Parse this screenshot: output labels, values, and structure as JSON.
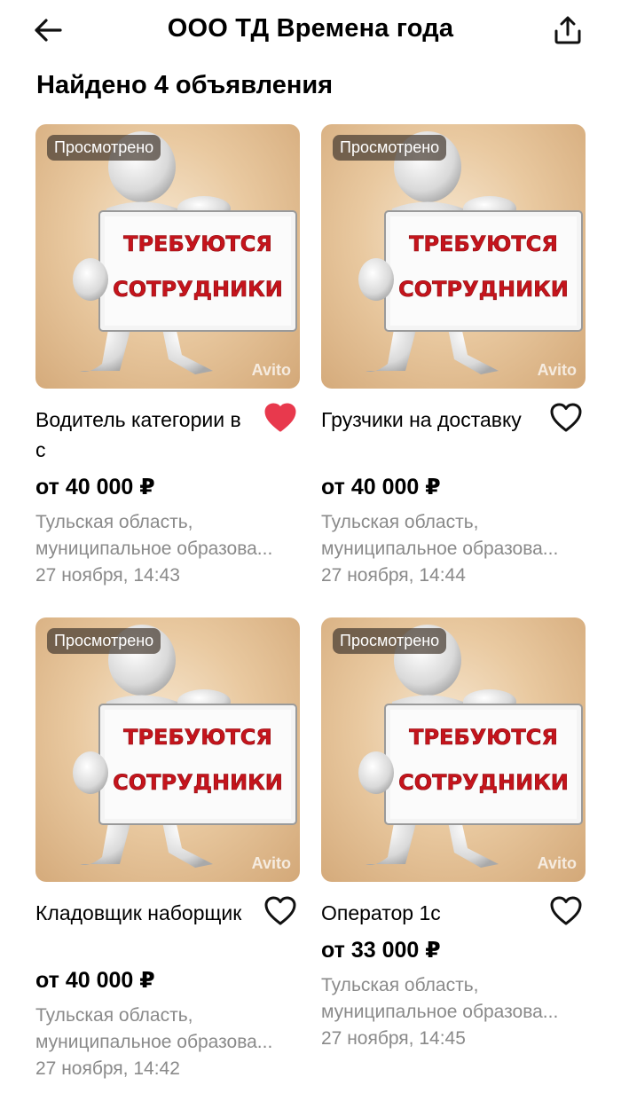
{
  "header": {
    "title": "ООО ТД Времена года",
    "back_icon": "arrow-left-icon",
    "share_icon": "share-upload-icon"
  },
  "results_count_text": "Найдено 4 объявления",
  "cards": [
    {
      "badge": "Просмотрено",
      "image_text_1": "ТРЕБУЮТСЯ",
      "image_text_2": "СОТРУДНИКИ",
      "watermark": "Avito",
      "title": "Водитель категории в с",
      "price": "от 40 000 ₽",
      "location_1": "Тульская область,",
      "location_2": "муниципальное образова...",
      "date": "27 ноября, 14:43",
      "favorited": true
    },
    {
      "badge": "Просмотрено",
      "image_text_1": "ТРЕБУЮТСЯ",
      "image_text_2": "СОТРУДНИКИ",
      "watermark": "Avito",
      "title": "Грузчики на доставку",
      "price": "от 40 000 ₽",
      "location_1": "Тульская область,",
      "location_2": "муниципальное образова...",
      "date": "27 ноября, 14:44",
      "favorited": false
    },
    {
      "badge": "Просмотрено",
      "image_text_1": "ТРЕБУЮТСЯ",
      "image_text_2": "СОТРУДНИКИ",
      "watermark": "Avito",
      "title": "Кладовщик наборщик",
      "price": "от 40 000 ₽",
      "location_1": "Тульская область,",
      "location_2": "муниципальное образова...",
      "date": "27 ноября, 14:42",
      "favorited": false
    },
    {
      "badge": "Просмотрено",
      "image_text_1": "ТРЕБУЮТСЯ",
      "image_text_2": "СОТРУДНИКИ",
      "watermark": "Avito",
      "title": "Оператор 1с",
      "price": "от 33 000 ₽",
      "location_1": "Тульская область,",
      "location_2": "муниципальное образова...",
      "date": "27 ноября, 14:45",
      "favorited": false
    }
  ],
  "colors": {
    "favorite_active": "#e8394d",
    "meta_text": "#8a8a8a",
    "sign_text": "#c5141c"
  }
}
